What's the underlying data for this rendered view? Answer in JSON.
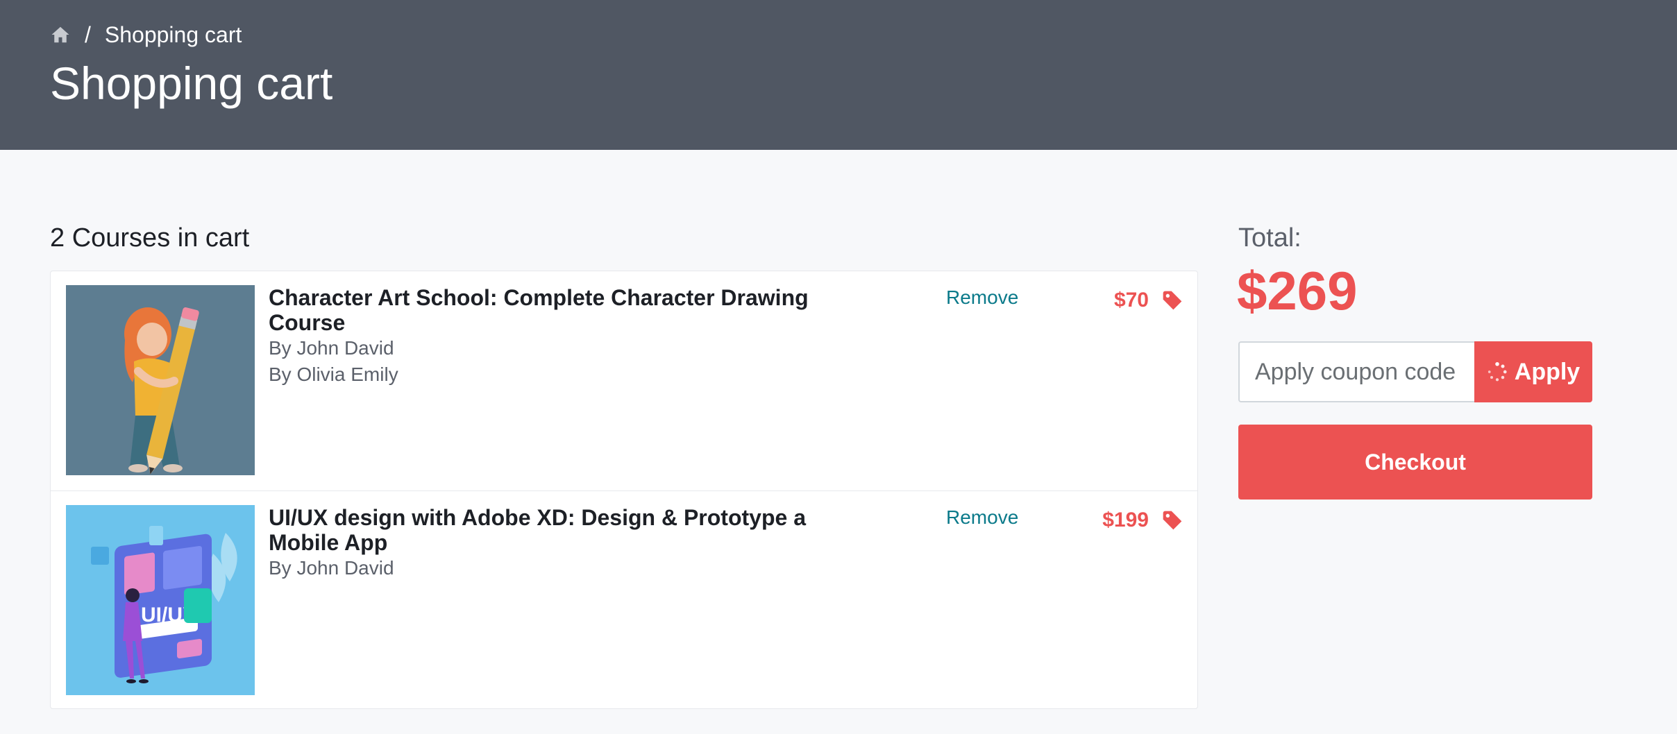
{
  "header": {
    "breadcrumb": {
      "home_icon": "home-icon",
      "separator": "/",
      "current": "Shopping cart"
    },
    "title": "Shopping cart"
  },
  "cart": {
    "count_label": "2 Courses in cart",
    "items": [
      {
        "title": "Character Art School: Complete Character Drawing Course",
        "authors": [
          "By John David",
          "By Olivia Emily"
        ],
        "remove_label": "Remove",
        "price": "$70",
        "tag_icon": "price-tag-icon",
        "thumbnail": "girl-holding-pencil-illustration"
      },
      {
        "title": "UI/UX design with Adobe XD: Design & Prototype a Mobile App",
        "authors": [
          "By John David"
        ],
        "remove_label": "Remove",
        "price": "$199",
        "tag_icon": "price-tag-icon",
        "thumbnail": "ui-ux-design-illustration",
        "thumbnail_text": "UI/UX"
      }
    ]
  },
  "summary": {
    "total_label": "Total:",
    "total_amount": "$269",
    "coupon_placeholder": "Apply coupon code",
    "apply_label": "Apply",
    "checkout_label": "Checkout"
  },
  "colors": {
    "header_bg": "#505763",
    "accent": "#ec5252",
    "link": "#0b7a8a",
    "page_bg": "#f7f8fa"
  }
}
